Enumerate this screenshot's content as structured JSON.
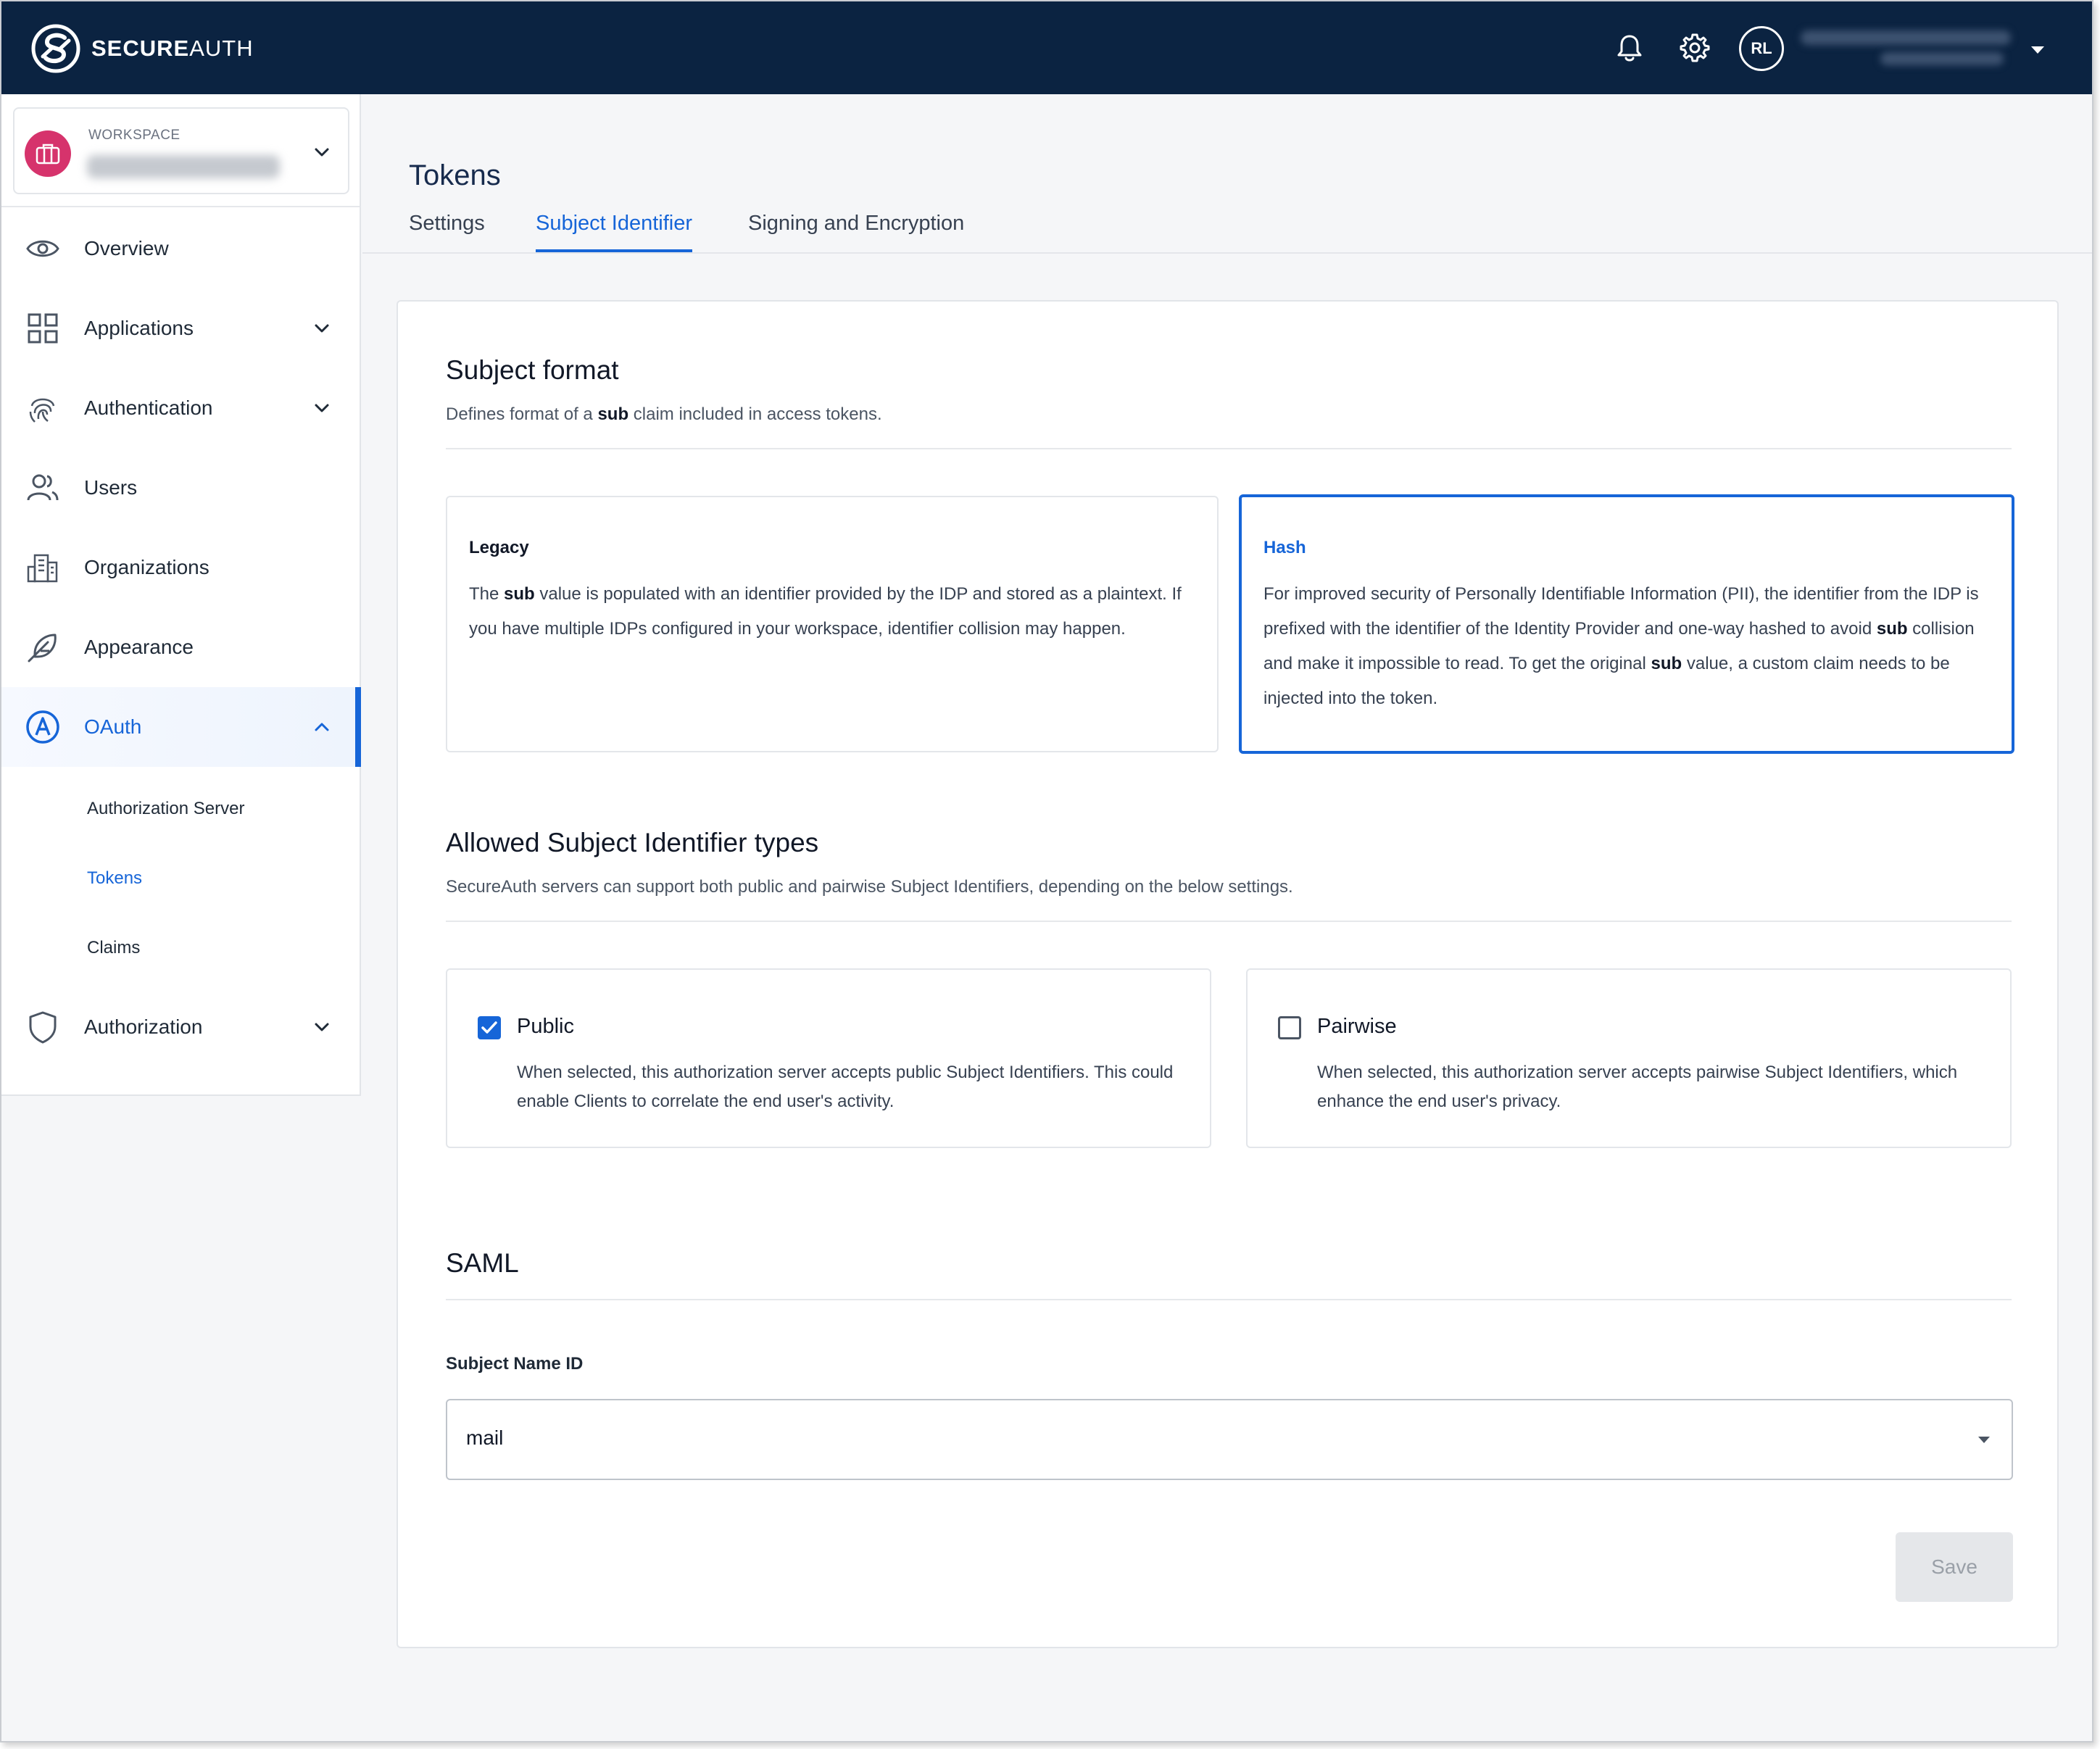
{
  "brand": {
    "name_bold": "SECURE",
    "name_rest": "AUTH"
  },
  "topbar": {
    "avatar_initials": "RL"
  },
  "workspace": {
    "label": "WORKSPACE"
  },
  "sidebar": {
    "items": [
      {
        "label": "Overview"
      },
      {
        "label": "Applications"
      },
      {
        "label": "Authentication"
      },
      {
        "label": "Users"
      },
      {
        "label": "Organizations"
      },
      {
        "label": "Appearance"
      },
      {
        "label": "OAuth"
      },
      {
        "label": "Authorization"
      }
    ],
    "oauth_sub": [
      {
        "label": "Authorization Server"
      },
      {
        "label": "Tokens"
      },
      {
        "label": "Claims"
      }
    ]
  },
  "page": {
    "title": "Tokens",
    "tabs": [
      {
        "label": "Settings"
      },
      {
        "label": "Subject Identifier"
      },
      {
        "label": "Signing and Encryption"
      }
    ]
  },
  "subject_format": {
    "title": "Subject format",
    "desc_pre": "Defines format of a ",
    "desc_bold": "sub",
    "desc_post": " claim included in access tokens.",
    "legacy": {
      "title": "Legacy",
      "p1": "The ",
      "b1": "sub",
      "p2": " value is populated with an identifier provided by the IDP and stored as a plaintext. If you have multiple IDPs configured in your workspace, identifier collision may happen."
    },
    "hash": {
      "title": "Hash",
      "p1": "For improved security of Personally Identifiable Information (PII), the identifier from the IDP is prefixed with the identifier of the Identity Provider and one-way hashed to avoid ",
      "b1": "sub",
      "p2": " collision and make it impossible to read. To get the original ",
      "b2": "sub",
      "p3": " value, a custom claim needs to be injected into the token."
    }
  },
  "allowed_types": {
    "title": "Allowed Subject Identifier types",
    "desc": "SecureAuth servers can support both public and pairwise Subject Identifiers, depending on the below settings.",
    "public": {
      "label": "Public",
      "desc": "When selected, this authorization server accepts public Subject Identifiers. This could enable Clients to correlate the end user's activity."
    },
    "pairwise": {
      "label": "Pairwise",
      "desc": "When selected, this authorization server accepts pairwise Subject Identifiers, which enhance the end user's privacy."
    }
  },
  "saml": {
    "title": "SAML",
    "field_label": "Subject Name ID",
    "value": "mail",
    "save_label": "Save"
  },
  "colors": {
    "accent": "#1665d8",
    "topbar": "#0b2341",
    "workspace_badge": "#d6336c"
  }
}
